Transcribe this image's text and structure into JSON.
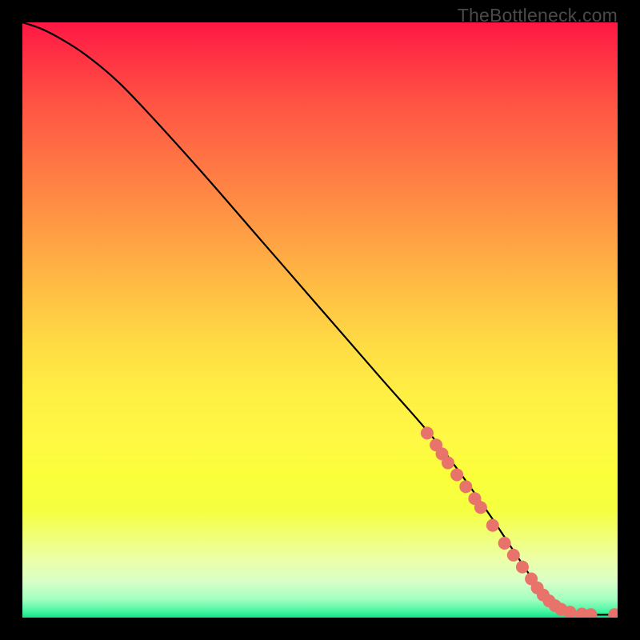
{
  "watermark": "TheBottleneck.com",
  "chart_data": {
    "type": "line",
    "title": "",
    "xlabel": "",
    "ylabel": "",
    "xlim": [
      0,
      100
    ],
    "ylim": [
      0,
      100
    ],
    "series": [
      {
        "name": "curve",
        "stroke": "#000000",
        "x": [
          0,
          3,
          6,
          10,
          15,
          20,
          30,
          40,
          50,
          60,
          70,
          78,
          82,
          86,
          88,
          90,
          93,
          96,
          100
        ],
        "values": [
          100,
          99,
          97.5,
          95,
          91,
          86,
          75,
          63.5,
          52,
          40.5,
          29,
          18,
          12,
          6,
          3,
          1.5,
          0.8,
          0.5,
          0.5
        ]
      }
    ],
    "markers": {
      "name": "dots",
      "color": "#e8736b",
      "radius_px": 8,
      "x": [
        68,
        69.5,
        70.5,
        71.5,
        73,
        74.5,
        76,
        77,
        79,
        81,
        82.5,
        84,
        85.5,
        86.5,
        87.5,
        88.5,
        89.5,
        90.5,
        92,
        94,
        95.5,
        99.5
      ],
      "values": [
        31,
        29,
        27.5,
        26,
        24,
        22,
        20,
        18.5,
        15.5,
        12.5,
        10.5,
        8.5,
        6.5,
        5,
        3.8,
        2.8,
        2,
        1.4,
        0.9,
        0.6,
        0.5,
        0.5
      ]
    }
  }
}
